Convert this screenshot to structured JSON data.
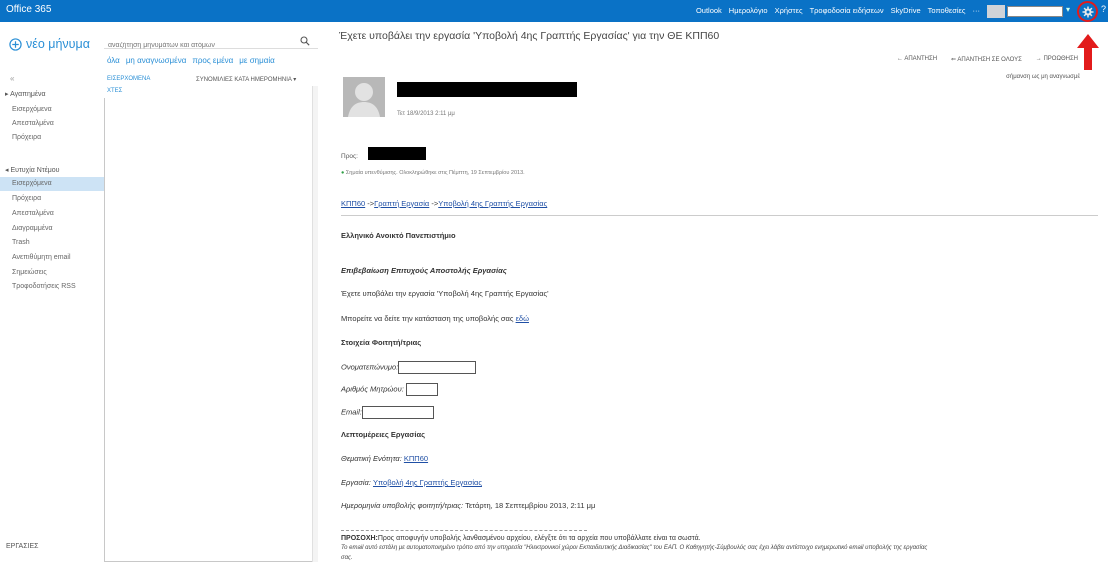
{
  "app": {
    "brand": "Office 365",
    "nav": [
      "Outlook",
      "Ημερολόγιο",
      "Χρήστες",
      "Τροφοδοσία ειδήσεων",
      "SkyDrive",
      "Τοποθεσίες",
      "···"
    ],
    "help": "?"
  },
  "sidebar": {
    "new_message": "νέο μήνυμα",
    "collapse": "«",
    "favorites_header": "▸ Αγαπημένα",
    "favorites": [
      "Εισερχόμενα",
      "Απεσταλμένα",
      "Πρόχειρα"
    ],
    "account_header": "◂ Ευτυχία Ντέμου",
    "folders": [
      "Εισερχόμενα",
      "Πρόχειρα",
      "Απεσταλμένα",
      "Διαγραμμένα",
      "Trash",
      "Ανεπιθύμητη email",
      "Σημειώσεις",
      "Τροφοδοτήσεις RSS"
    ],
    "tasks": "ΕΡΓΑΣΙΕΣ"
  },
  "list": {
    "search_placeholder": "αναζήτηση μηνυμάτων και ατόμων",
    "filters": [
      "όλα",
      "μη αναγνωσμένα",
      "προς εμένα",
      "με σημαία"
    ],
    "inbox_label": "ΕΙΣΕΡΧΟΜΕΝΑ",
    "sort_label": "ΣΥΝΟΜΙΛΙΕΣ ΚΑΤΑ ΗΜΕΡΟΜΗΝΙΑ ▾",
    "group_label": "ΧΤΕΣ"
  },
  "message": {
    "subject": "Έχετε υποβάλει την εργασία 'Υποβολή 4ης Γραπτής Εργασίας' για την ΘΕ ΚΠΠ60",
    "actions": [
      "ΑΠΑΝΤΗΣΗ",
      "ΑΠΑΝΤΗΣΗ ΣΕ ΟΛΟΥΣ",
      "ΠΡΟΩΘΗΣΗ"
    ],
    "mark_unread": "σήμανση ως μη αναγνωσμέ",
    "timestamp": "Τετ 18/9/2013 2:11 μμ",
    "to_label": "Προς:",
    "importance": "Σημαία υπενθύμισης. Ολοκληρώθηκε στις Πέμπτη, 19 Σεπτεμβρίου 2013.",
    "breadcrumb": [
      "ΚΠΠ60",
      "Γραπτή Εργασία",
      "Υποβολή 4ης Γραπτής Εργασίας"
    ],
    "breadcrumb_sep": " ->",
    "university": "Ελληνικό Ανοικτό Πανεπιστήμιο",
    "confirm_title": "Επιβεβαίωση Επιτυχούς Αποστολής Εργασίας",
    "submitted_text": "Έχετε υποβάλει την εργασία 'Υποβολή 4ης Γραπτής Εργασίας'",
    "status_text": "Μπορείτε να δείτε την κατάσταση της υποβολής σας",
    "status_link": "εδώ",
    "student_header": "Στοιχεία Φοιτητή/τριας",
    "name_label": "Ονοματεπώνυμο:",
    "reg_label": "Αριθμός Μητρώου:",
    "email_label": "Email:",
    "details_header": "Λεπτομέρειες Εργασίας",
    "unit_label": "Θεματική Ενότητα:",
    "unit_value": "ΚΠΠ60",
    "work_label": "Εργασία:",
    "work_value": "Υποβολή 4ης Γραπτής Εργασίας",
    "date_label": "Ημερομηνία υποβολής φοιτητή/τριας:",
    "date_value": "Τετάρτη, 18 Σεπτεμβρίου 2013, 2:11 μμ",
    "attention_bold": "ΠΡΟΣΟΧΗ:",
    "attention_text": "Προς αποφυγήν υποβολής λανθασμένου αρχείου, ελέγξτε ότι τα αρχεία που υποβάλλατε είναι τα σωστά.",
    "footer_line1": "Το email αυτό εστάλη με αυτοματοποιημένο τρόπο από την υπηρεσία \"Ηλεκτρονικοί χώροι Εκπαιδευτικής Διαδικασίας\" του ΕΑΠ. Ο Καθηγητής-Σύμβουλός σας έχει λάβει αντίστοιχο ενημερωτικό email υποβολής της εργασίας",
    "footer_line2": "σας."
  }
}
